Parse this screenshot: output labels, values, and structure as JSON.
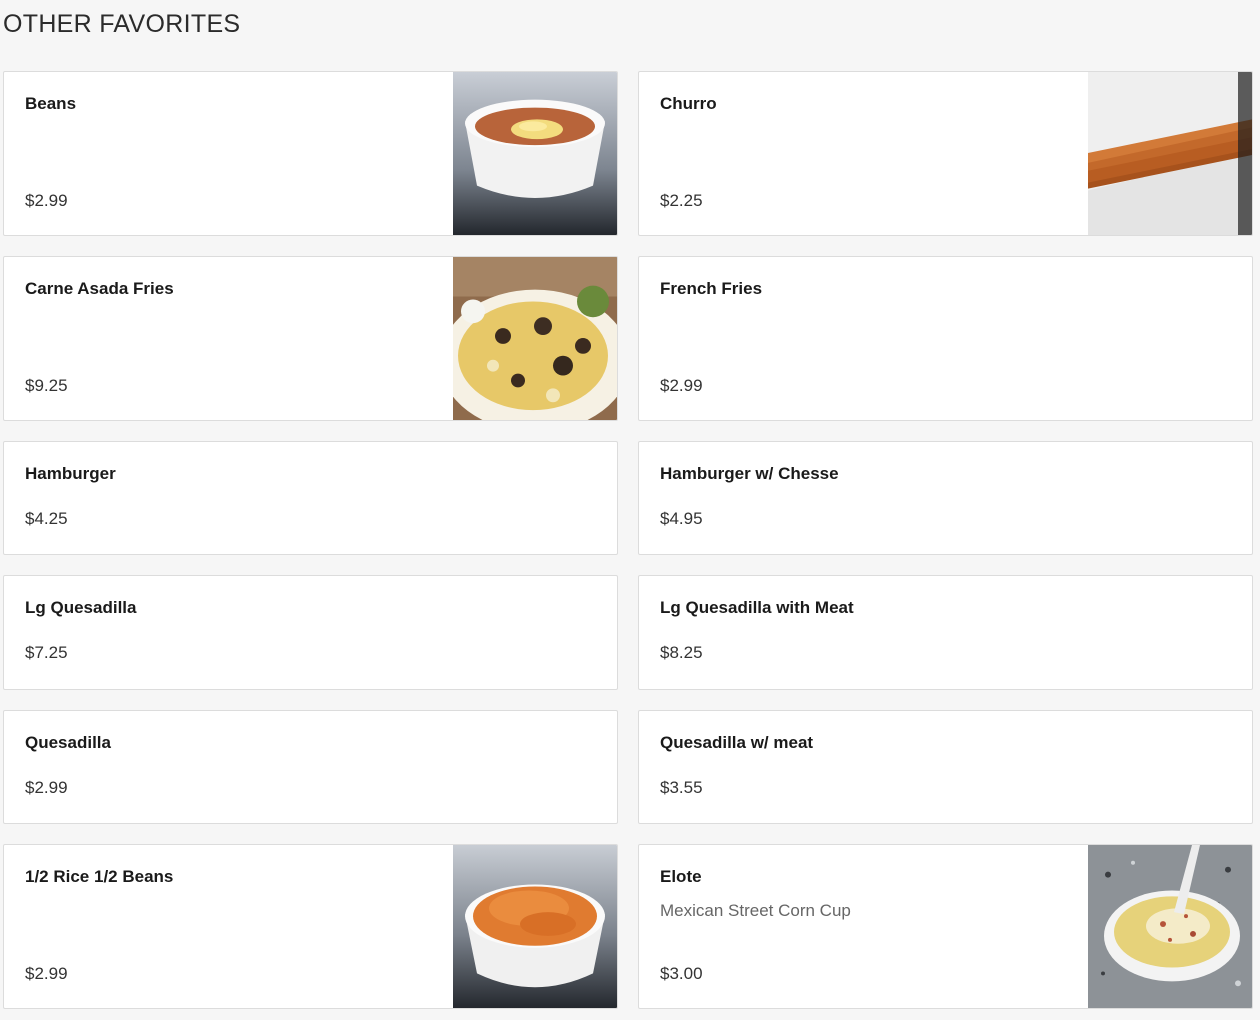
{
  "section": {
    "title": "OTHER FAVORITES"
  },
  "items": [
    {
      "name": "Beans",
      "price": "$2.99",
      "image": "beans-bowl-image"
    },
    {
      "name": "Churro",
      "price": "$2.25",
      "image": "churro-image"
    },
    {
      "name": "Carne Asada Fries",
      "price": "$9.25",
      "image": "carne-asada-fries-image"
    },
    {
      "name": "French Fries",
      "price": "$2.99"
    },
    {
      "name": "Hamburger",
      "price": "$4.25"
    },
    {
      "name": "Hamburger w/ Chesse",
      "price": "$4.95"
    },
    {
      "name": "Lg Quesadilla",
      "price": "$7.25"
    },
    {
      "name": "Lg Quesadilla with Meat",
      "price": "$8.25"
    },
    {
      "name": "Quesadilla",
      "price": "$2.99"
    },
    {
      "name": "Quesadilla w/ meat",
      "price": "$3.55"
    },
    {
      "name": "1/2 Rice 1/2 Beans",
      "price": "$2.99",
      "image": "rice-bowl-image"
    },
    {
      "name": "Elote",
      "description": "Mexican Street Corn Cup",
      "price": "$3.00",
      "image": "elote-cup-image"
    }
  ]
}
